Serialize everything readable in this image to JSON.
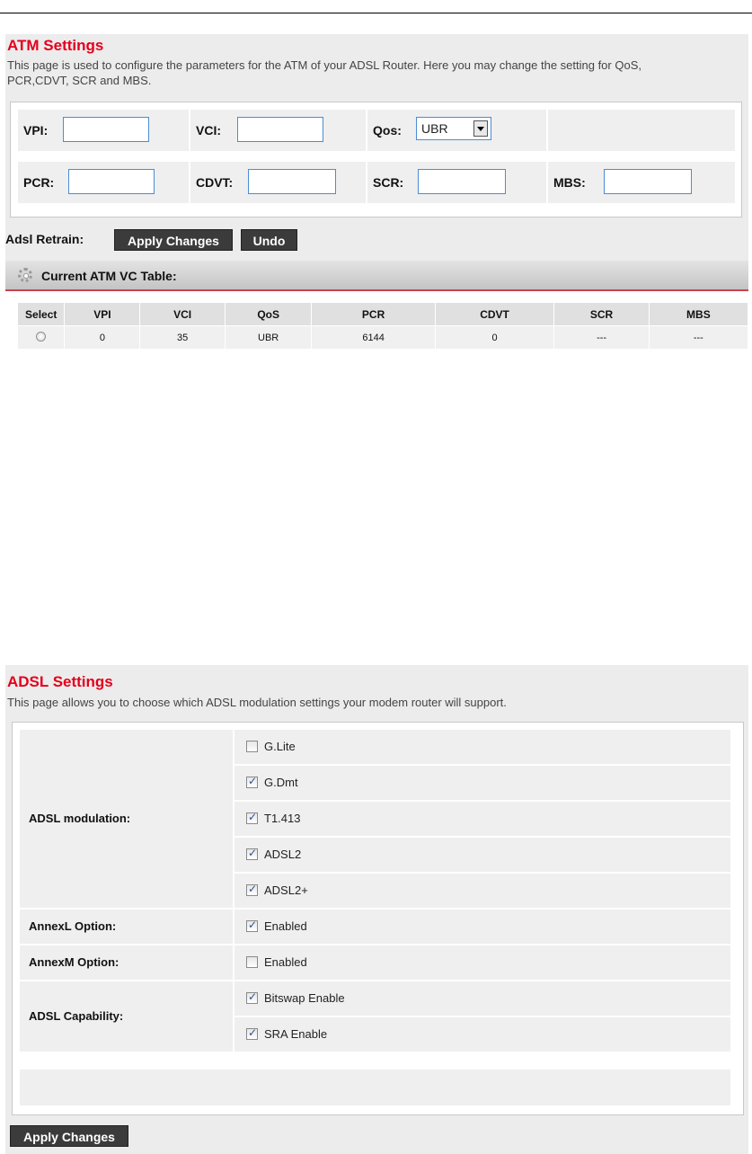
{
  "atm": {
    "title": "ATM Settings",
    "description_line1": "This page is used to configure the parameters for the ATM of your ADSL Router. Here you may change the setting for QoS,",
    "description_line2": "PCR,CDVT, SCR and MBS.",
    "fields": {
      "vpi_label": "VPI:",
      "vpi_value": "",
      "vci_label": "VCI:",
      "vci_value": "",
      "qos_label": "Qos:",
      "qos_value": "UBR",
      "pcr_label": "PCR:",
      "pcr_value": "",
      "cdvt_label": "CDVT:",
      "cdvt_value": "",
      "scr_label": "SCR:",
      "scr_value": "",
      "mbs_label": "MBS:",
      "mbs_value": ""
    },
    "retrain_label": "Adsl Retrain:",
    "apply_label": "Apply Changes",
    "undo_label": "Undo",
    "table_title": "Current ATM VC Table:",
    "table": {
      "headers": [
        "Select",
        "VPI",
        "VCI",
        "QoS",
        "PCR",
        "CDVT",
        "SCR",
        "MBS"
      ],
      "rows": [
        {
          "selected": false,
          "vpi": "0",
          "vci": "35",
          "qos": "UBR",
          "pcr": "6144",
          "cdvt": "0",
          "scr": "---",
          "mbs": "---"
        }
      ]
    }
  },
  "adsl": {
    "title": "ADSL Settings",
    "description": "This page allows you to choose which ADSL modulation settings your modem router will support.",
    "modulation_label": "ADSL modulation:",
    "modulation_options": [
      {
        "label": "G.Lite",
        "checked": false
      },
      {
        "label": "G.Dmt",
        "checked": true
      },
      {
        "label": "T1.413",
        "checked": true
      },
      {
        "label": "ADSL2",
        "checked": true
      },
      {
        "label": "ADSL2+",
        "checked": true
      }
    ],
    "annexl_label": "AnnexL Option:",
    "annexl_option": {
      "label": "Enabled",
      "checked": true
    },
    "annexm_label": "AnnexM Option:",
    "annexm_option": {
      "label": "Enabled",
      "checked": false
    },
    "capability_label": "ADSL Capability:",
    "capability_options": [
      {
        "label": "Bitswap Enable",
        "checked": true
      },
      {
        "label": "SRA Enable",
        "checked": true
      }
    ],
    "apply_label": "Apply Changes"
  },
  "colors": {
    "title_red": "#e4001b",
    "button_dark": "#3b3b3b",
    "input_border": "#4a8dd5",
    "panel_bg": "#ececec"
  }
}
